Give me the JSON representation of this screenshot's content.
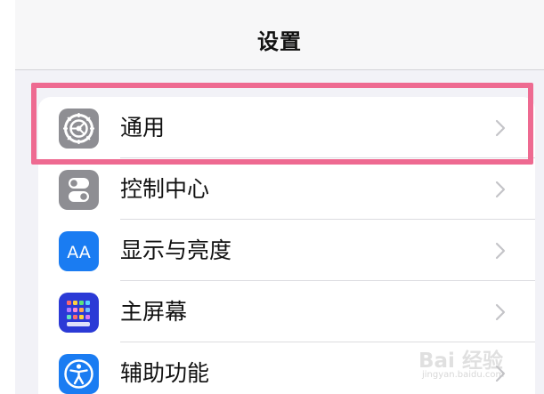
{
  "nav": {
    "title": "设置"
  },
  "settings": {
    "items": [
      {
        "label": "通用",
        "icon": "gear-icon",
        "icon_color": "#8e8e93"
      },
      {
        "label": "控制中心",
        "icon": "toggles-icon",
        "icon_color": "#8e8e93"
      },
      {
        "label": "显示与亮度",
        "icon": "text-size-icon",
        "icon_color": "#1a7cf2",
        "icon_text": "AA"
      },
      {
        "label": "主屏幕",
        "icon": "home-screen-grid-icon",
        "icon_color": "#2b3ad6"
      },
      {
        "label": "辅助功能",
        "icon": "accessibility-icon",
        "icon_color": "#1a7cf2"
      }
    ]
  },
  "highlight": {
    "color": "#ee6a91",
    "target": "通用"
  },
  "watermark": {
    "main": "Bai 经验",
    "sub": "jingyan.baidu.com"
  }
}
